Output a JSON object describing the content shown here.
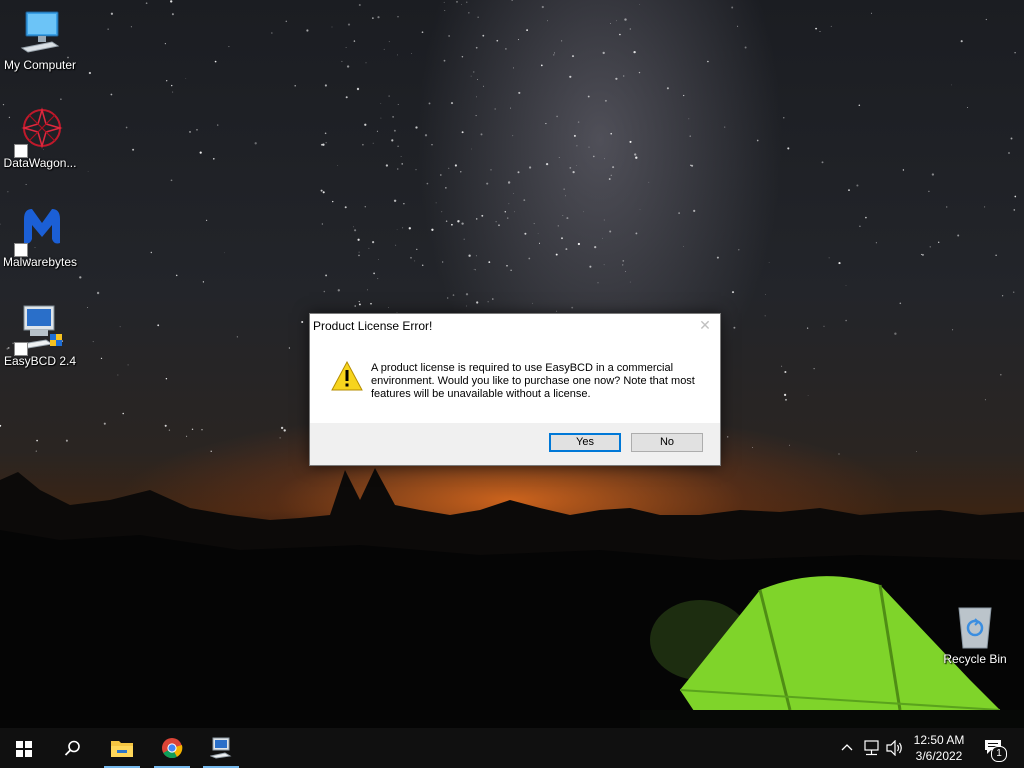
{
  "desktop": {
    "icons": [
      {
        "label": "My Computer",
        "icon": "monitor-icon"
      },
      {
        "label": "DataWagon...",
        "icon": "datawagon-icon"
      },
      {
        "label": "Malwarebytes",
        "icon": "malwarebytes-icon"
      },
      {
        "label": "EasyBCD 2.4",
        "icon": "easybcd-icon"
      },
      {
        "label": "Recycle Bin",
        "icon": "recycle-bin-icon"
      }
    ]
  },
  "dialog": {
    "title": "Product License Error!",
    "close_glyph": "✕",
    "message": "A product license is required to use EasyBCD in a commercial environment. Would you like to purchase one now? Note that most features will be unavailable without a license.",
    "yes_label": "Yes",
    "no_label": "No"
  },
  "taskbar": {
    "apps": [
      "start-icon",
      "search-icon",
      "file-explorer-icon",
      "chrome-icon",
      "easybcd-icon"
    ],
    "tray_chevron": "^",
    "time": "12:50 AM",
    "date": "3/6/2022",
    "notification_count": "1"
  },
  "colors": {
    "accent": "#0078d7",
    "taskbar": "#101010",
    "tent": "#7fd42a"
  }
}
